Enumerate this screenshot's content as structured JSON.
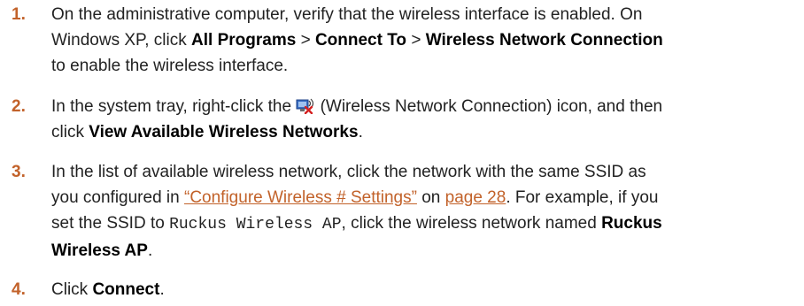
{
  "steps": [
    {
      "number": "1.",
      "line1": "On the administrative computer, verify that the wireless interface is enabled. On",
      "line2_pre": "Windows XP, click ",
      "line2_b1": "All Programs",
      "line2_sep1": " > ",
      "line2_b2": "Connect To",
      "line2_sep2": " > ",
      "line2_b3": "Wireless Network Connection",
      "line3": "to enable the wireless interface."
    },
    {
      "number": "2.",
      "line1_pre": "In the system tray, right-click the ",
      "icon_name": "wireless-network-connection-icon",
      "line1_post": " (Wireless Network Connection) icon, and then",
      "line2_pre": "click ",
      "line2_b": "View Available Wireless Networks",
      "line2_post": "."
    },
    {
      "number": "3.",
      "line1": "In the list of available wireless network, click the network with the same SSID as",
      "line2_pre": "you configured in ",
      "link_section": "“Configure Wireless # Settings”",
      "line2_mid": " on ",
      "link_page": "page 28",
      "line2_post": ". For example, if you",
      "line3_pre": "set the SSID to ",
      "ssid_code": "Ruckus Wireless AP",
      "line3_mid": ", click the wireless network named ",
      "line3_b": "Ruckus",
      "line4_b": "Wireless AP",
      "line4_post": "."
    },
    {
      "number": "4.",
      "pre": "Click ",
      "b": "Connect",
      "post": "."
    }
  ],
  "colors": {
    "accent": "#c2622a",
    "text": "#222222"
  }
}
